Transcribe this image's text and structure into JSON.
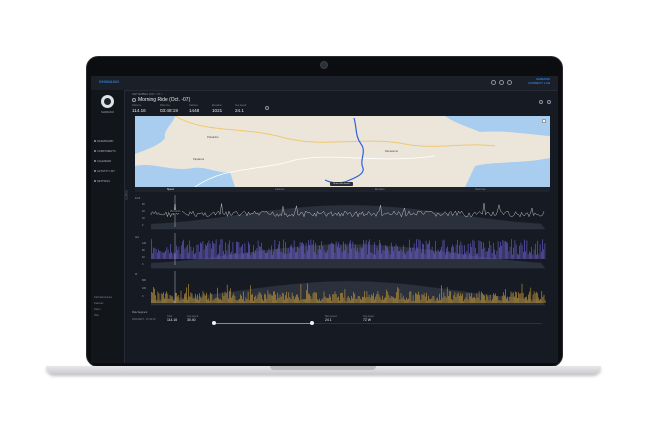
{
  "brand": {
    "left": "SHIMANO",
    "right_line1": "SHIMANO",
    "right_line2": "CONNECT LAB"
  },
  "profile": {
    "name": "SHIMANO"
  },
  "sidebar": {
    "items": [
      {
        "label": "DASHBOARD"
      },
      {
        "label": "COMPONENTS"
      },
      {
        "label": "CALENDAR"
      },
      {
        "label": "ACTIVITY LIST"
      },
      {
        "label": "SETTINGS"
      }
    ],
    "footer": [
      "Fahrradcomputer",
      "Kalender",
      "Daten",
      "Hilfe"
    ]
  },
  "activity": {
    "breadcrumb": "SEPTEMBER 2021 > 07 >",
    "title": "Morning Ride (Oct. -07)",
    "stats": [
      {
        "label": "Distance",
        "value": "114.16"
      },
      {
        "label": "Ride time",
        "value": "03:48:19"
      },
      {
        "label": "Calories",
        "value": "1448"
      },
      {
        "label": "Elevation",
        "value": "1021"
      },
      {
        "label": "Avg speed",
        "value": "24.1"
      }
    ]
  },
  "map": {
    "places": [
      "Pukekohe",
      "Papakura",
      "Ramarama"
    ],
    "show_button": "Show ride details"
  },
  "tabs": [
    "Speed",
    "Cadence",
    "Elevation",
    "Heart rate"
  ],
  "charts": {
    "speed": {
      "axis_label": "km/h",
      "ticks": [
        "60",
        "40",
        "20",
        "0"
      ],
      "marker": "25.6 km/h"
    },
    "cadence": {
      "axis_label": "rpm",
      "ticks": [
        "120",
        "80",
        "40",
        "0"
      ]
    },
    "power": {
      "axis_label": "W",
      "ticks": [
        "800",
        "400",
        "0"
      ]
    }
  },
  "bottom": {
    "section": "Ride Segment",
    "date": "2021/09/07 - 07:40:29",
    "values": [
      {
        "label": "Total",
        "value": "114.16"
      },
      {
        "label": "Avg speed",
        "value": "30.40"
      },
      {
        "label": "Max speed",
        "value": "24.1"
      },
      {
        "label": "Avg power",
        "value": "72 W"
      }
    ],
    "progress": 0.3
  }
}
